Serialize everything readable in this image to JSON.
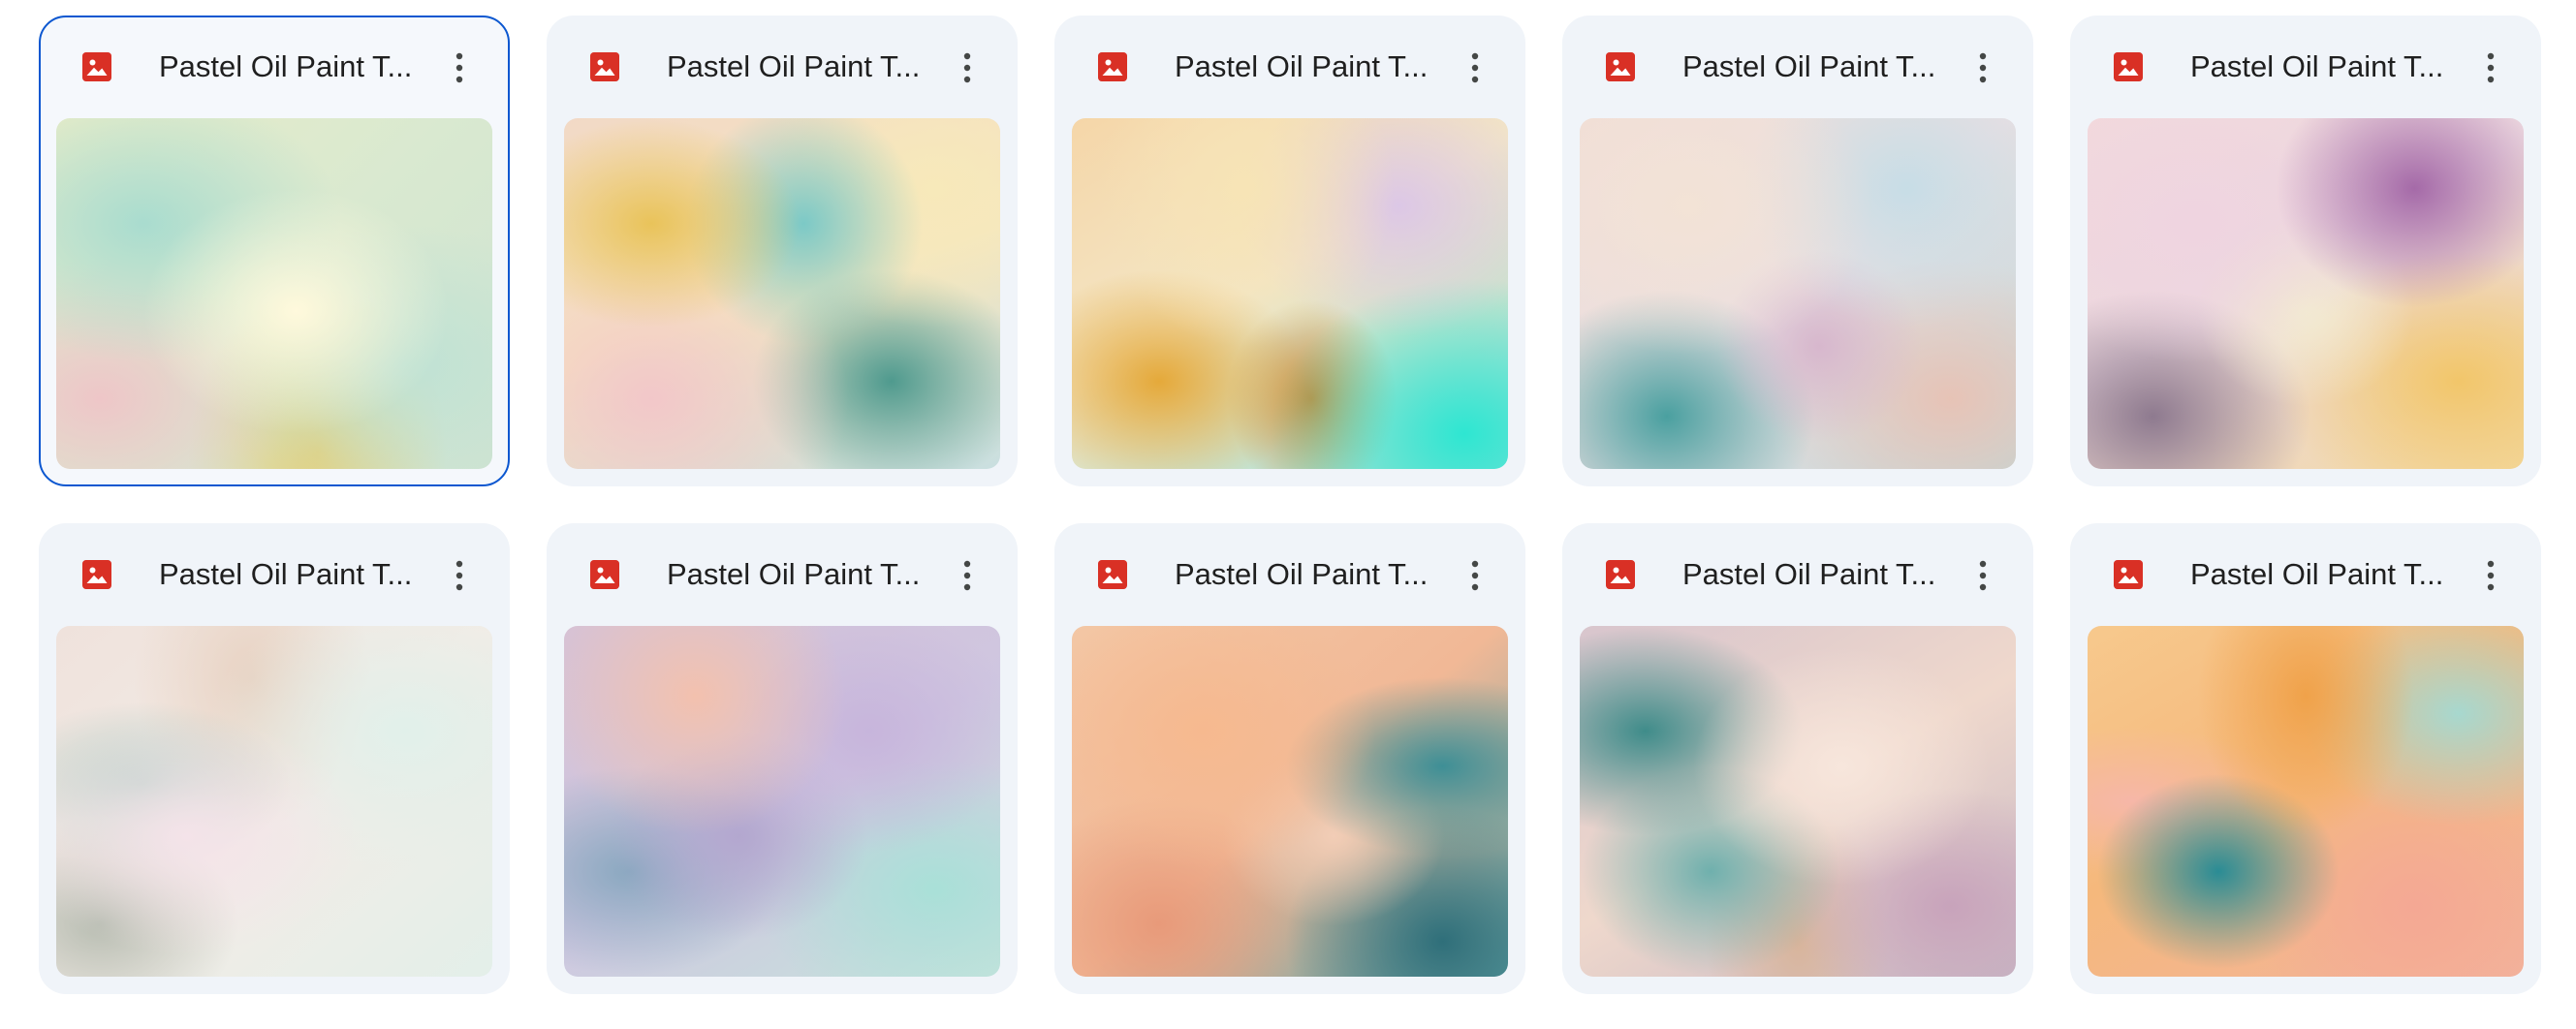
{
  "files": [
    {
      "title": "Pastel Oil Paint T...",
      "selected": true,
      "thumb_class": "p1"
    },
    {
      "title": "Pastel Oil Paint T...",
      "selected": false,
      "thumb_class": "p2"
    },
    {
      "title": "Pastel Oil Paint T...",
      "selected": false,
      "thumb_class": "p3"
    },
    {
      "title": "Pastel Oil Paint T...",
      "selected": false,
      "thumb_class": "p4"
    },
    {
      "title": "Pastel Oil Paint T...",
      "selected": false,
      "thumb_class": "p5"
    },
    {
      "title": "Pastel Oil Paint T...",
      "selected": false,
      "thumb_class": "p6"
    },
    {
      "title": "Pastel Oil Paint T...",
      "selected": false,
      "thumb_class": "p7"
    },
    {
      "title": "Pastel Oil Paint T...",
      "selected": false,
      "thumb_class": "p8"
    },
    {
      "title": "Pastel Oil Paint T...",
      "selected": false,
      "thumb_class": "p9"
    },
    {
      "title": "Pastel Oil Paint T...",
      "selected": false,
      "thumb_class": "p10"
    }
  ],
  "icons": {
    "file_type": "image-file-icon",
    "menu": "more-vert-icon"
  },
  "colors": {
    "card_bg": "#f0f4f9",
    "selected_border": "#0b57d0",
    "image_icon_red": "#d93025",
    "title_text": "#1f1f1f",
    "menu_icon": "#444746"
  }
}
